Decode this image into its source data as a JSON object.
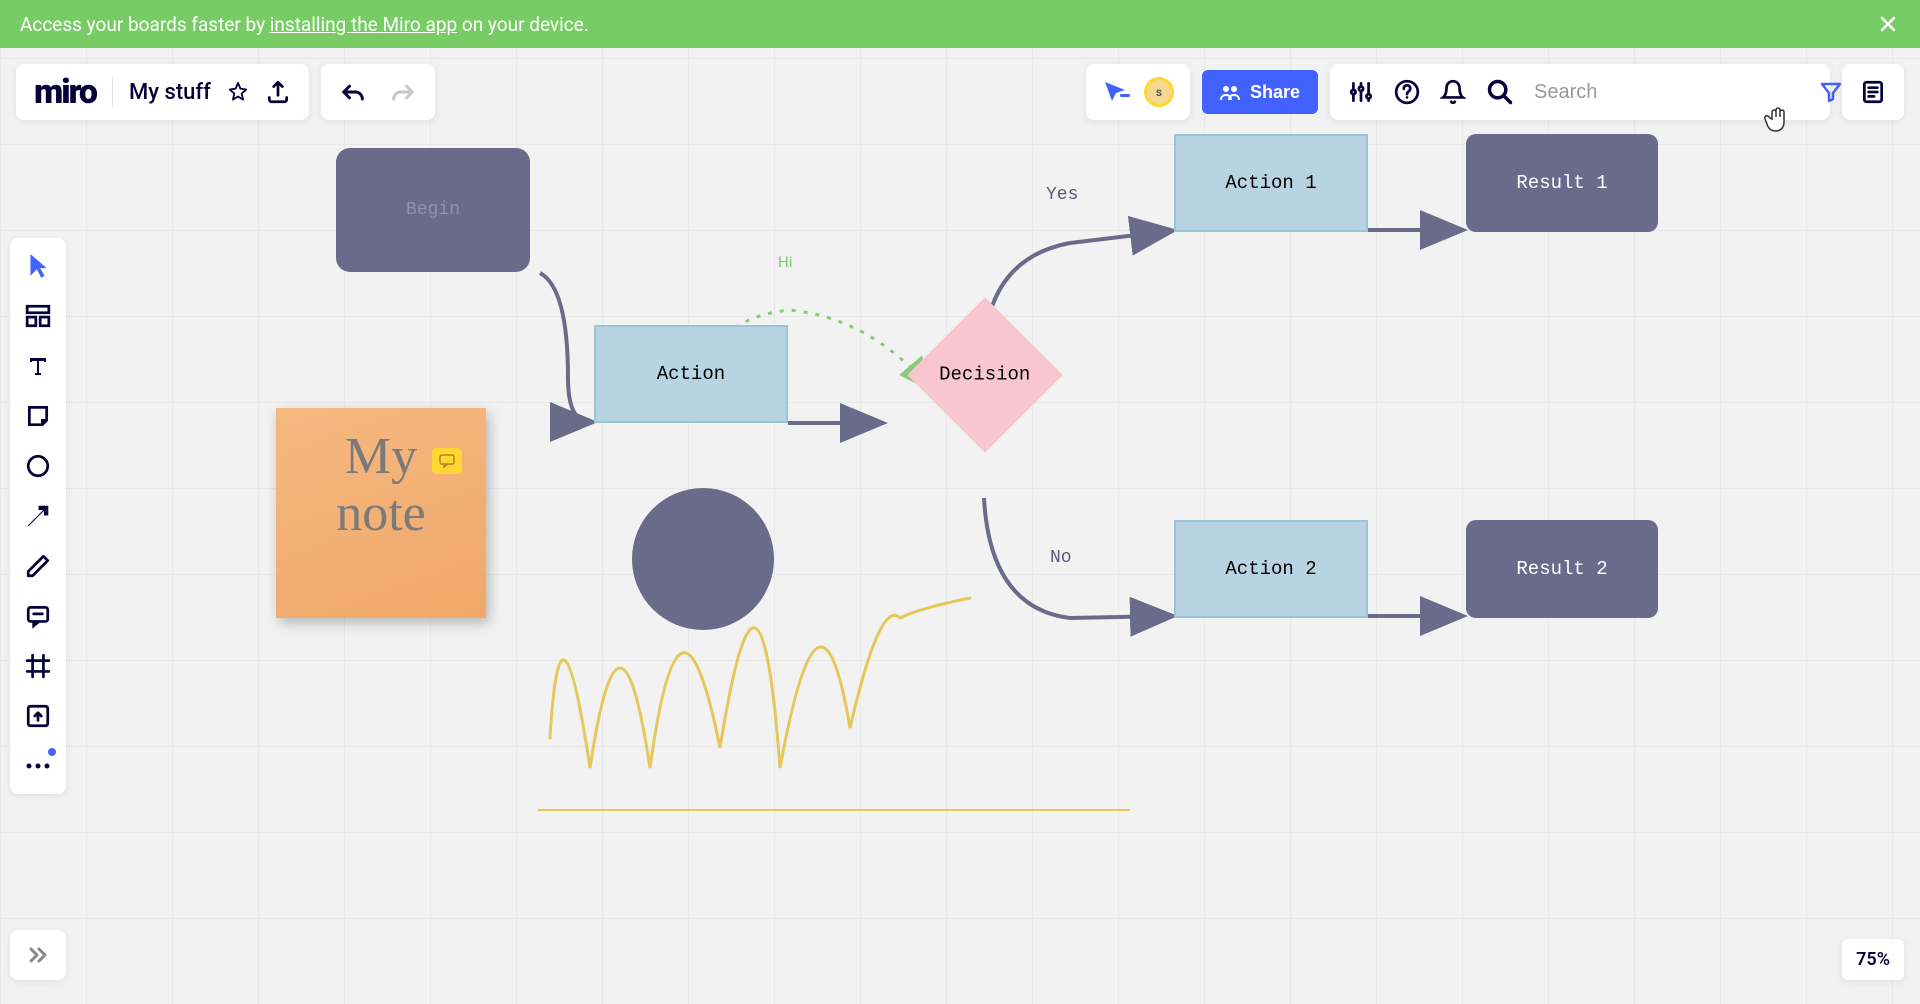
{
  "banner": {
    "text_prefix": "Access your boards faster by ",
    "link_text": "installing the Miro app",
    "text_suffix": " on your device."
  },
  "header": {
    "logo": "miro",
    "board_name": "My stuff",
    "share_label": "Share",
    "search_placeholder": "Search",
    "avatar_initial": "s"
  },
  "canvas": {
    "start_label": "Begin",
    "action_label": "Action",
    "decision_label": "Decision",
    "action1_label": "Action 1",
    "action2_label": "Action 2",
    "result1_label": "Result 1",
    "result2_label": "Result 2",
    "yes_label": "Yes",
    "no_label": "No",
    "hi_label": "Hi",
    "sticky_text": "My note"
  },
  "zoom": "75%"
}
